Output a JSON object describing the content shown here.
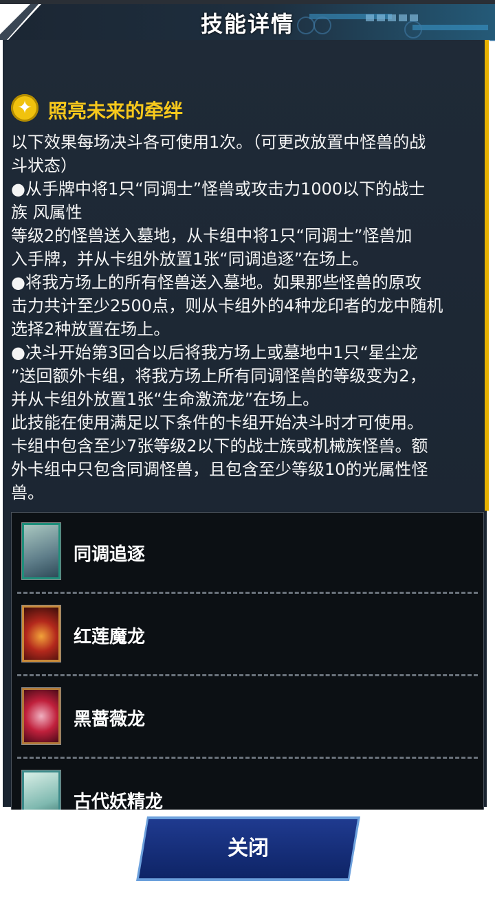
{
  "header": {
    "title": "技能详情"
  },
  "skill": {
    "name": "照亮未来的牵绊",
    "icon": "sparkle-star-icon",
    "description_lines": [
      "以下效果每场决斗各可使用1次。（可更改放置中怪兽的战",
      "斗状态）",
      "●从手牌中将1只“同调士”怪兽或攻击力1000以下的战士",
      "族 风属性",
      "等级2的怪兽送入墓地，从卡组中将1只“同调士”怪兽加",
      "入手牌，并从卡组外放置1张“同调追逐”在场上。",
      "●将我方场上的所有怪兽送入墓地。如果那些怪兽的原攻",
      "击力共计至少2500点，则从卡组外的4种龙印者的龙中随机",
      "选择2种放置在场上。",
      "●决斗开始第3回合以后将我方场上或墓地中1只“星尘龙",
      "”送回额外卡组，将我方场上所有同调怪兽的等级变为2，",
      "并从卡组外放置1张“生命激流龙”在场上。",
      "此技能在使用满足以下条件的卡组开始决斗时才可使用。",
      "卡组中包含至少7张等级2以下的战士族或机械族怪兽。额",
      "外卡组中只包含同调怪兽，且包含至少等级10的光属性怪",
      "兽。"
    ]
  },
  "cards": [
    {
      "name": "同调追逐",
      "kind": "spell"
    },
    {
      "name": "红莲魔龙",
      "kind": "monster"
    },
    {
      "name": "黑蔷薇龙",
      "kind": "monster"
    },
    {
      "name": "古代妖精龙",
      "kind": "monster"
    }
  ],
  "footer": {
    "close_label": "关闭"
  },
  "colors": {
    "accent_gold": "#f7c81c",
    "panel_bg": "#1c2633",
    "button_blue": "#1f3a8f"
  }
}
